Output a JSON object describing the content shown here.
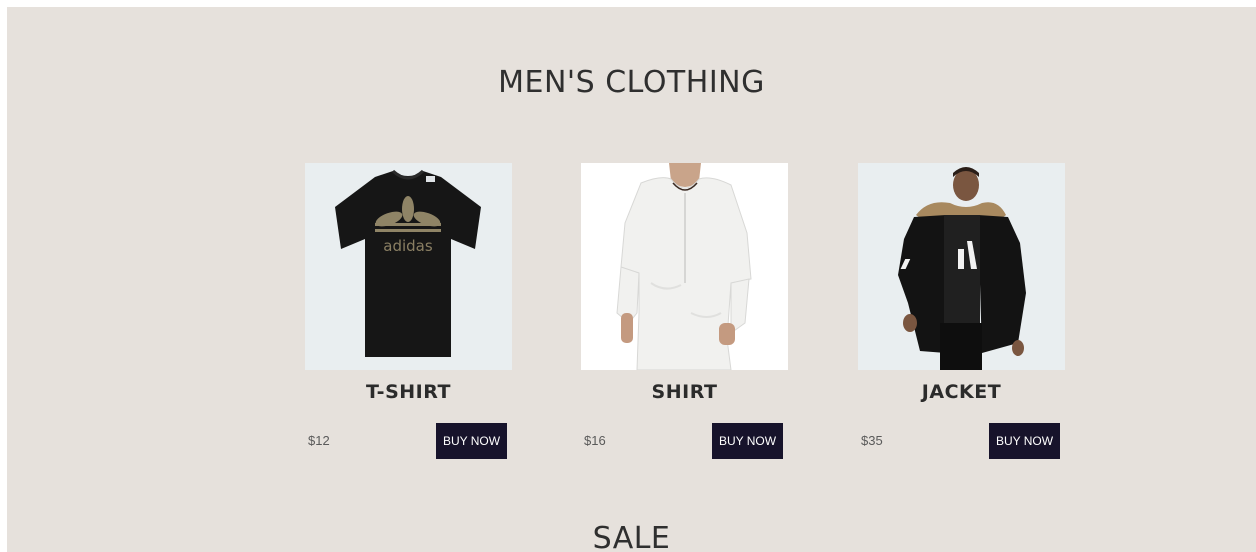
{
  "sections": {
    "men_title": "MEN'S CLOTHING",
    "sale_title": "SALE"
  },
  "products": [
    {
      "name": "T-SHIRT",
      "price": "$12",
      "button": "BUY NOW",
      "image_icon": "tshirt-image"
    },
    {
      "name": "SHIRT",
      "price": "$16",
      "button": "BUY NOW",
      "image_icon": "shirt-image"
    },
    {
      "name": "JACKET",
      "price": "$35",
      "button": "BUY NOW",
      "image_icon": "jacket-image"
    }
  ],
  "colors": {
    "background": "#e6e1dc",
    "button": "#17132b",
    "image_bg_light": "#e9eef0"
  }
}
